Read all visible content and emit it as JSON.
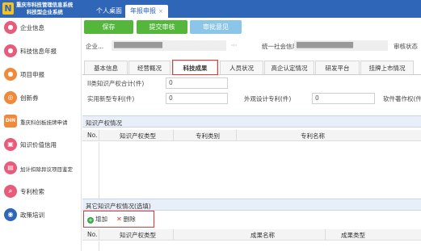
{
  "header": {
    "logo_mark": "N",
    "logo_line1": "重庆市科技管理信息系统",
    "logo_line2": "科技型企业系统",
    "tabs": [
      {
        "label": "个人桌面"
      },
      {
        "label": "年报申报",
        "close": "×"
      }
    ]
  },
  "sidebar": {
    "items": [
      {
        "label": "企业信息",
        "icon": "enterprise-icon",
        "color": "#e85b7a",
        "glyph": "●"
      },
      {
        "label": "科技信息年报",
        "icon": "report-icon",
        "color": "#e85b7a",
        "glyph": "●"
      },
      {
        "label": "项目申报",
        "icon": "project-icon",
        "color": "#f08a3a",
        "glyph": "●"
      },
      {
        "label": "创新券",
        "icon": "voucher-icon",
        "color": "#f08a3a",
        "glyph": "◎"
      },
      {
        "label": "重庆科创板挂牌申请",
        "icon": "listing-icon",
        "color": "#f08a3a",
        "glyph": "D"
      },
      {
        "label": "知识价值信用",
        "icon": "credit-icon",
        "color": "#e85b7a",
        "glyph": "▣"
      },
      {
        "label": "加计扣除异议项目鉴定",
        "icon": "deduction-icon",
        "color": "#e85b7a",
        "glyph": "▤"
      },
      {
        "label": "专利检索",
        "icon": "patent-search-icon",
        "color": "#e85b7a",
        "glyph": "⌕"
      },
      {
        "label": "政策培训",
        "icon": "policy-icon",
        "color": "#2f66b8",
        "glyph": "◉"
      }
    ]
  },
  "toolbar": {
    "save": "保存",
    "submit": "提交审核",
    "opinion": "审批意见"
  },
  "info": {
    "company_label": "企业...",
    "company_value": "████████████",
    "more": "···",
    "credit_label": "统一社会信用...",
    "credit_value": "██████████████",
    "status_label": "审核状态"
  },
  "tabs": [
    {
      "label": "基本信息"
    },
    {
      "label": "经营概况"
    },
    {
      "label": "科技成果",
      "active": true
    },
    {
      "label": "人员状况"
    },
    {
      "label": "高企认定情况"
    },
    {
      "label": "研发平台"
    },
    {
      "label": "挂牌上市情况"
    }
  ],
  "form": {
    "row1_label": "II类知识产权合计(件)",
    "row1_value": "0",
    "row2_label_a": "实用新型专利(件)",
    "row2_value_a": "0",
    "row2_label_b": "外观设计专利(件)",
    "row2_value_b": "0",
    "row2_label_c": "软件著作权(件)"
  },
  "ip_section": {
    "title": "知识产权情况",
    "columns": [
      "No.",
      "知识产权类型",
      "专利类别",
      "专利名称"
    ]
  },
  "other_section": {
    "title": "其它知识产权情况(选填)",
    "add": "增加",
    "delete": "删除",
    "columns": [
      "No.",
      "知识产权类型",
      "成果名称",
      "成果类型"
    ]
  }
}
